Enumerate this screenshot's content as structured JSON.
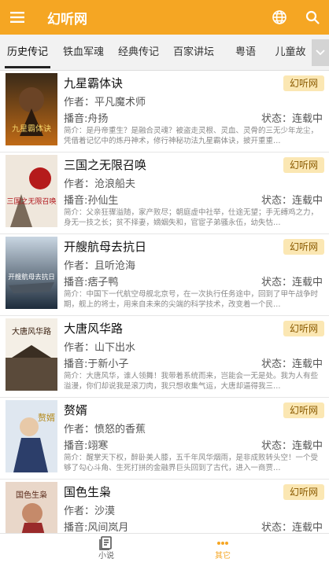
{
  "app": {
    "title": "幻听网"
  },
  "icons": {
    "menu": "menu-icon",
    "globe": "globe-icon",
    "search": "search-icon",
    "more": "chevron-down-icon"
  },
  "colors": {
    "brand": "#f5a623",
    "badge_bg": "#fbe7b3"
  },
  "tabs": [
    {
      "label": "历史传记",
      "active": true
    },
    {
      "label": "铁血军魂"
    },
    {
      "label": "经典传记"
    },
    {
      "label": "百家讲坛"
    },
    {
      "label": "粤语"
    },
    {
      "label": "儿童故"
    }
  ],
  "books": [
    {
      "title": "九星霸体诀",
      "source": "幻听网",
      "author": "作者：平凡魔术师",
      "narrator": "播音:舟扬",
      "status": "状态：连载中",
      "intro": "简介：是丹帝重生？是融合灵魂？被盗走灵根、灵血、灵骨的三无少年龙尘，凭借着记忆中的炼丹神术，修行神秘功法九星霸体诀，披开重重…",
      "cover_text": "九星霸体诀"
    },
    {
      "title": "三国之无限召唤",
      "source": "幻听网",
      "author": "作者：沧浪船夫",
      "narrator": "播音:孙仙生",
      "status": "状态：连载中",
      "intro": "简介：父亲狂骤溢随，家产败尽；朝庭虚中社举，仕途无望；手无缚鸡之力，身无一技之长；贫不择妻，嫡姻失和，官宦子弟骚永伍，幼失怙…",
      "cover_text": "三国之无限召唤"
    },
    {
      "title": "开艘航母去抗日",
      "source": "幻听网",
      "author": "作者：且听沧海",
      "narrator": "播音:痞子鸭",
      "status": "状态：连载中",
      "intro": "简介：中国下一代航空母舰北京号，在一次执行任务途中，回到了甲午战争时期，舰上的将士，用来自未来的尖端的科学技术，改变着一个民…",
      "cover_text": "开艘航母去抗日"
    },
    {
      "title": "大唐风华路",
      "source": "幻听网",
      "author": "作者：山下出水",
      "narrator": "播音:于新小子",
      "status": "状态：连载中",
      "intro": "简介：大唐风华，谁人领舞！我带着系统而来，岂能会一无是处。我为人有些溢漫，你们却说我是滚刀肉，我只想收集气运，大唐却逼得我三…",
      "cover_text": "大唐风华路"
    },
    {
      "title": "赘婿",
      "source": "幻听网",
      "author": "作者：愤怒的香蕉",
      "narrator": "播音:翊寒",
      "status": "状态：连载中",
      "intro": "简介：醒掌天下权，醉卧美人膝，五千年风华烟雨，是非成败转头空！一个受够了勾心斗角、生死打拼的金融界巨头回到了古代，进入一商贾…",
      "cover_text": "赘婿"
    },
    {
      "title": "国色生枭",
      "source": "幻听网",
      "author": "作者：沙漠",
      "narrator": "播音:风间岚月",
      "status": "状态：连载中",
      "intro": "",
      "cover_text": "国色生枭"
    }
  ],
  "bottom_nav": [
    {
      "label": "小说",
      "icon": "book-icon"
    },
    {
      "label": "其它",
      "icon": "more-dots-icon",
      "active": true
    }
  ]
}
